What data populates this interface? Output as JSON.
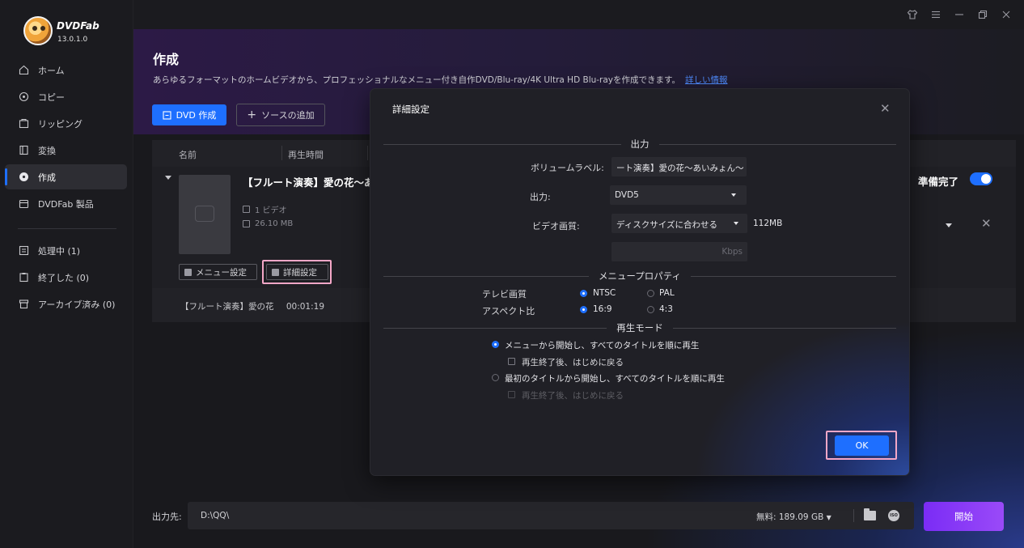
{
  "app": {
    "brand": "DVDFab",
    "version": "13.0.1.0"
  },
  "sidebar": {
    "items": [
      {
        "label": "ホーム",
        "icon": "home-icon"
      },
      {
        "label": "コピー",
        "icon": "copy-icon"
      },
      {
        "label": "リッピング",
        "icon": "ripper-icon"
      },
      {
        "label": "変換",
        "icon": "converter-icon"
      },
      {
        "label": "作成",
        "icon": "creator-icon",
        "active": true
      },
      {
        "label": "DVDFab 製品",
        "icon": "products-icon"
      }
    ],
    "queue": [
      {
        "label": "処理中 (1)",
        "icon": "processing-icon"
      },
      {
        "label": "終了した (0)",
        "icon": "finished-icon"
      },
      {
        "label": "アーカイブ済み (0)",
        "icon": "archive-icon"
      }
    ]
  },
  "main": {
    "title": "作成",
    "description": "あらゆるフォーマットのホームビデオから、プロフェッショナルなメニュー付き自作DVD/Blu-ray/4K Ultra HD Blu-rayを作成できます。",
    "more_info": "詳しい情報 ",
    "create_button": "DVD 作成",
    "add_source_button": "ソースの追加",
    "columns": {
      "name": "名前",
      "duration": "再生時間"
    },
    "file": {
      "title": "【フルート演奏】愛の花〜あいみょん〜",
      "videos": "1 ビデオ",
      "size": "26.10 MB",
      "menu_settings": "メニュー設定",
      "advanced_settings": "詳細設定",
      "ready": "準備完了",
      "sub_title": "【フルート演奏】愛の花",
      "sub_duration": "00:01:19"
    },
    "footer": {
      "label": "出力先:",
      "path": "D:\\QQ\\",
      "free_space": "無料: 189.09 GB",
      "start": "開始"
    }
  },
  "dialog": {
    "title": "詳細設定",
    "output_section": "出力",
    "volume_label_label": "ボリュームラベル:",
    "volume_label_value": "ート演奏】愛の花〜あいみょん〜",
    "output_label": "出力:",
    "output_value": "DVD5",
    "video_quality_label": "ビデオ画質:",
    "video_quality_value": "ディスクサイズに合わせる",
    "video_size": "112MB",
    "kbps_placeholder": "Kbps",
    "menu_section": "メニュープロパティ",
    "tv_label": "テレビ画質",
    "ntsc": "NTSC",
    "pal": "PAL",
    "aspect_label": "アスペクト比",
    "aspect_169": "16:9",
    "aspect_43": "4:3",
    "playback_section": "再生モード",
    "play_from_menu": "メニューから開始し、すべてのタイトルを順に再生",
    "return_after_1": "再生終了後、はじめに戻る",
    "play_from_first": "最初のタイトルから開始し、すべてのタイトルを順に再生",
    "return_after_2": "再生終了後、はじめに戻る",
    "ok": "OK"
  },
  "colors": {
    "accent": "#1e6fff",
    "start": "#8b3cf7",
    "highlight": "#f4a7c7"
  }
}
